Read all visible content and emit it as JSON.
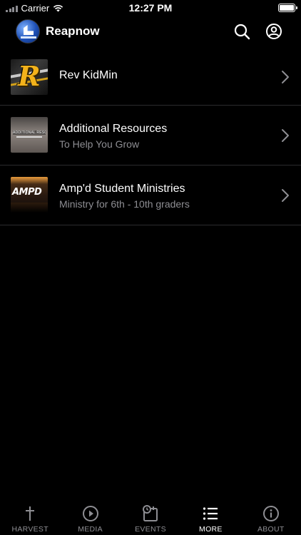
{
  "status_bar": {
    "carrier": "Carrier",
    "time": "12:27 PM"
  },
  "header": {
    "title": "Reapnow",
    "icons": [
      "search-icon",
      "account-icon"
    ]
  },
  "list": {
    "items": [
      {
        "title": "Rev KidMin",
        "subtitle": ""
      },
      {
        "title": "Additional Resources",
        "subtitle": "To Help You Grow",
        "thumb_text": "ADDITIONAL RESOURCES"
      },
      {
        "title": "Amp'd Student Ministries",
        "subtitle": "Ministry for 6th - 10th graders",
        "thumb_text": "AMPD"
      }
    ]
  },
  "tab_bar": {
    "tabs": [
      {
        "label": "HARVEST",
        "icon": "cross-icon"
      },
      {
        "label": "MEDIA",
        "icon": "play-circle-icon"
      },
      {
        "label": "EVENTS",
        "icon": "calendar-clock-icon"
      },
      {
        "label": "MORE",
        "icon": "list-icon",
        "active": true
      },
      {
        "label": "ABOUT",
        "icon": "info-icon"
      }
    ]
  },
  "colors": {
    "background": "#000000",
    "text_primary": "#ffffff",
    "text_secondary": "#8e8e93",
    "separator": "#2b2b2d"
  }
}
